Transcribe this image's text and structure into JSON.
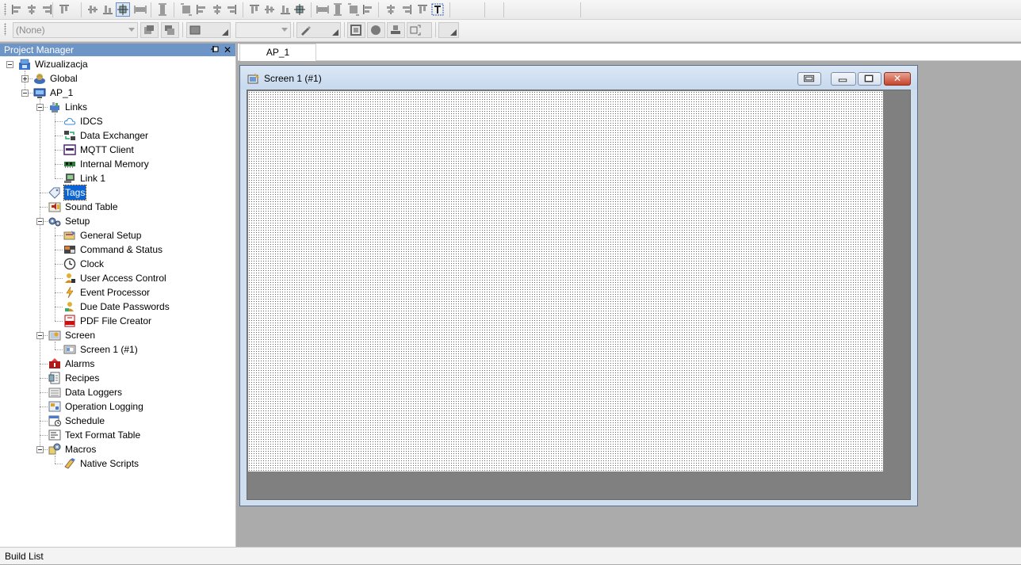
{
  "colors": {
    "panel_title_bg": "#6e95c7",
    "selection": "#0a64d4",
    "workspace": "#ababab",
    "canvas_border": "#808080"
  },
  "toolbar1": {
    "icons": [
      "align-left-icon",
      "align-center-icon",
      "align-right-icon",
      "align-top-icon",
      "align-middle-icon",
      "align-bottom-icon",
      "center-icon",
      "same-width-icon",
      "same-height-icon",
      "same-size-icon",
      "space-horizontal-icon",
      "space-vertical-icon",
      "distribute-icon",
      "layer-icon",
      "group-icon",
      "ungroup-icon",
      "front-icon",
      "back-icon",
      "forward-icon",
      "backward-icon",
      "rotate-icon",
      "flip-icon",
      "lock-icon",
      "unlock-icon",
      "text-icon"
    ]
  },
  "toolbar2": {
    "layer_combo_value": "(None)",
    "second_combo_value": ""
  },
  "project_manager": {
    "title": "Project Manager",
    "close_glyph": "✕",
    "tree": [
      {
        "label": "Wizualizacja",
        "icon": "workspace-icon",
        "level": 0,
        "expander": "minus"
      },
      {
        "label": "Global",
        "icon": "global-icon",
        "level": 1,
        "expander": "plus"
      },
      {
        "label": "AP_1",
        "icon": "project-icon",
        "level": 1,
        "expander": "minus"
      },
      {
        "label": "Links",
        "icon": "links-icon",
        "level": 2,
        "expander": "minus"
      },
      {
        "label": "IDCS",
        "icon": "cloud-icon",
        "level": 3
      },
      {
        "label": "Data Exchanger",
        "icon": "data-exchanger-icon",
        "level": 3
      },
      {
        "label": "MQTT Client",
        "icon": "mqtt-icon",
        "level": 3
      },
      {
        "label": "Internal Memory",
        "icon": "memory-icon",
        "level": 3
      },
      {
        "label": "Link 1",
        "icon": "link-icon",
        "level": 3
      },
      {
        "label": "Tags",
        "icon": "tags-icon",
        "level": 2,
        "selected": true
      },
      {
        "label": "Sound Table",
        "icon": "sound-table-icon",
        "level": 2
      },
      {
        "label": "Setup",
        "icon": "setup-icon",
        "level": 2,
        "expander": "minus"
      },
      {
        "label": "General Setup",
        "icon": "general-setup-icon",
        "level": 3
      },
      {
        "label": "Command & Status",
        "icon": "command-status-icon",
        "level": 3
      },
      {
        "label": "Clock",
        "icon": "clock-icon",
        "level": 3
      },
      {
        "label": "User Access Control",
        "icon": "user-access-icon",
        "level": 3
      },
      {
        "label": "Event Processor",
        "icon": "event-processor-icon",
        "level": 3
      },
      {
        "label": "Due Date Passwords",
        "icon": "due-date-passwords-icon",
        "level": 3
      },
      {
        "label": "PDF File Creator",
        "icon": "pdf-icon",
        "level": 3
      },
      {
        "label": "Screen",
        "icon": "screen-folder-icon",
        "level": 2,
        "expander": "minus"
      },
      {
        "label": "Screen 1 (#1)",
        "icon": "screen-icon",
        "level": 3
      },
      {
        "label": "Alarms",
        "icon": "alarms-icon",
        "level": 2
      },
      {
        "label": "Recipes",
        "icon": "recipes-icon",
        "level": 2
      },
      {
        "label": "Data Loggers",
        "icon": "data-loggers-icon",
        "level": 2
      },
      {
        "label": "Operation Logging",
        "icon": "operation-logging-icon",
        "level": 2
      },
      {
        "label": "Schedule",
        "icon": "schedule-icon",
        "level": 2
      },
      {
        "label": "Text Format Table",
        "icon": "text-format-icon",
        "level": 2
      },
      {
        "label": "Macros",
        "icon": "macros-icon",
        "level": 2,
        "expander": "minus"
      },
      {
        "label": "Native Scripts",
        "icon": "native-scripts-icon",
        "level": 3
      }
    ]
  },
  "document": {
    "tab_label": "AP_1",
    "window_title": "Screen 1 (#1)",
    "close_glyph": "✕"
  },
  "status": {
    "build_list_label": "Build List"
  }
}
